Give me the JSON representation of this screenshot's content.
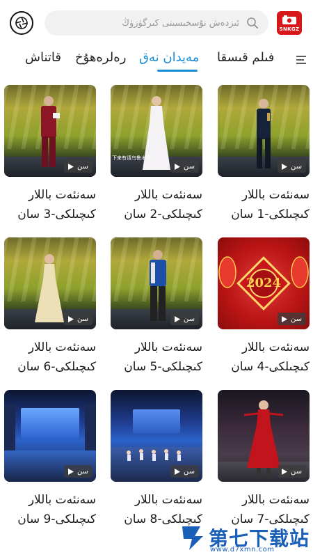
{
  "header": {
    "search_placeholder": "ئىزدەش نۇسخىسىنى كىرگۈزۈڭ",
    "logo_text": "SNKGZ"
  },
  "tabs": [
    {
      "label": "قاتناش"
    },
    {
      "label": "رەلرەھۇخ"
    },
    {
      "label": "مەيدان نەق",
      "active": true
    },
    {
      "label": "فىلم قىسقا"
    }
  ],
  "videos": [
    {
      "line1": "سەنئەت باللار",
      "line2": "كىچىلكى-1 سان",
      "badge": "سن"
    },
    {
      "line1": "سەنئەت باللار",
      "line2": "كىچىلكى-2 سان",
      "badge": "سن"
    },
    {
      "line1": "سەنئەت باللار",
      "line2": "كىچىلكى-3 سان",
      "badge": "سن"
    },
    {
      "line1": "سەنئەت باللار",
      "line2": "كىچىلكى-4 سان",
      "badge": "سن"
    },
    {
      "line1": "سەنئەت باللار",
      "line2": "كىچىلكى-5 سان",
      "badge": "سن"
    },
    {
      "line1": "سەنئەت باللار",
      "line2": "كىچىلكى-6 سان",
      "badge": "سن"
    },
    {
      "line1": "سەنئەت باللار",
      "line2": "كىچىلكى-7 سان",
      "badge": "سن"
    },
    {
      "line1": "سەنئەت باللار",
      "line2": "كىچىلكى-8 سان",
      "badge": "سن"
    },
    {
      "line1": "سەنئەت باللار",
      "line2": "كىچىلكى-9 سان",
      "badge": "سن"
    }
  ],
  "thumb_text": {
    "year": "2024",
    "caption": "下来有请乌鲁木齐"
  },
  "watermark": {
    "name": "第七下载站",
    "url": "www.d7xmn.com"
  },
  "colors": {
    "accent": "#1a8bd6",
    "logo_red": "#d7161b"
  }
}
